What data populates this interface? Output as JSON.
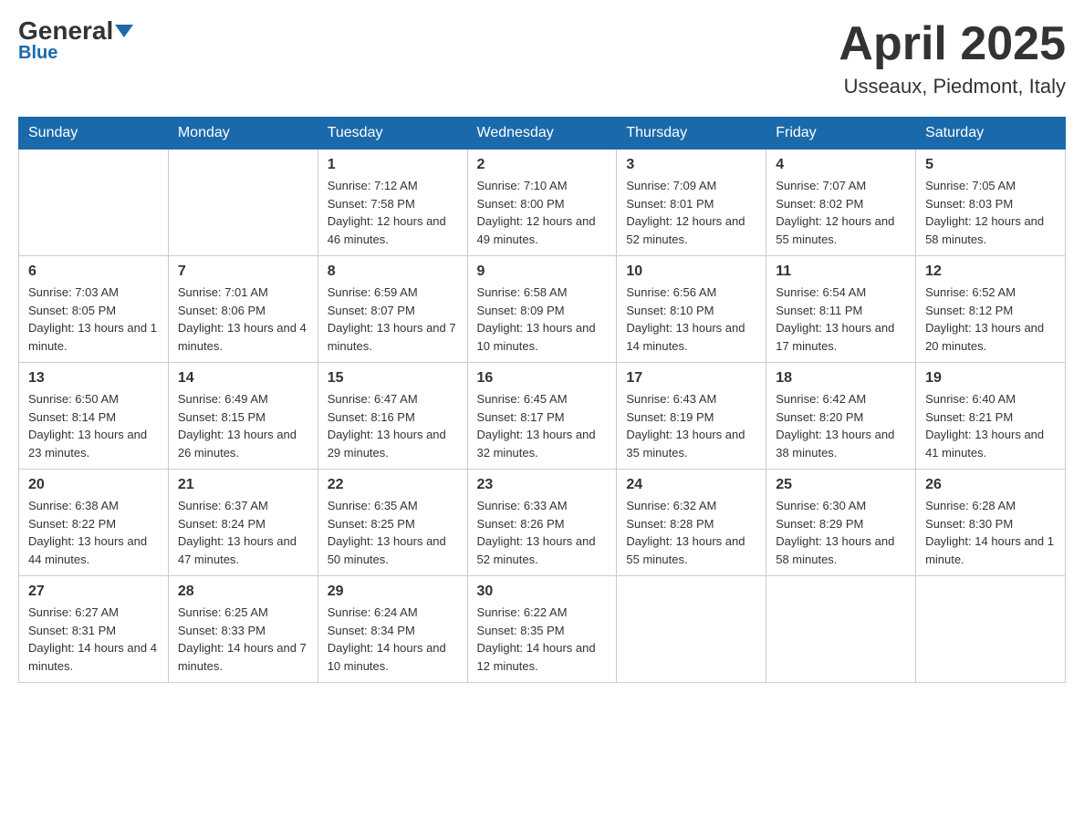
{
  "header": {
    "logo_general": "General",
    "logo_blue": "Blue",
    "month_year": "April 2025",
    "location": "Usseaux, Piedmont, Italy"
  },
  "days_of_week": [
    "Sunday",
    "Monday",
    "Tuesday",
    "Wednesday",
    "Thursday",
    "Friday",
    "Saturday"
  ],
  "weeks": [
    [
      {
        "day": "",
        "sunrise": "",
        "sunset": "",
        "daylight": ""
      },
      {
        "day": "",
        "sunrise": "",
        "sunset": "",
        "daylight": ""
      },
      {
        "day": "1",
        "sunrise": "Sunrise: 7:12 AM",
        "sunset": "Sunset: 7:58 PM",
        "daylight": "Daylight: 12 hours and 46 minutes."
      },
      {
        "day": "2",
        "sunrise": "Sunrise: 7:10 AM",
        "sunset": "Sunset: 8:00 PM",
        "daylight": "Daylight: 12 hours and 49 minutes."
      },
      {
        "day": "3",
        "sunrise": "Sunrise: 7:09 AM",
        "sunset": "Sunset: 8:01 PM",
        "daylight": "Daylight: 12 hours and 52 minutes."
      },
      {
        "day": "4",
        "sunrise": "Sunrise: 7:07 AM",
        "sunset": "Sunset: 8:02 PM",
        "daylight": "Daylight: 12 hours and 55 minutes."
      },
      {
        "day": "5",
        "sunrise": "Sunrise: 7:05 AM",
        "sunset": "Sunset: 8:03 PM",
        "daylight": "Daylight: 12 hours and 58 minutes."
      }
    ],
    [
      {
        "day": "6",
        "sunrise": "Sunrise: 7:03 AM",
        "sunset": "Sunset: 8:05 PM",
        "daylight": "Daylight: 13 hours and 1 minute."
      },
      {
        "day": "7",
        "sunrise": "Sunrise: 7:01 AM",
        "sunset": "Sunset: 8:06 PM",
        "daylight": "Daylight: 13 hours and 4 minutes."
      },
      {
        "day": "8",
        "sunrise": "Sunrise: 6:59 AM",
        "sunset": "Sunset: 8:07 PM",
        "daylight": "Daylight: 13 hours and 7 minutes."
      },
      {
        "day": "9",
        "sunrise": "Sunrise: 6:58 AM",
        "sunset": "Sunset: 8:09 PM",
        "daylight": "Daylight: 13 hours and 10 minutes."
      },
      {
        "day": "10",
        "sunrise": "Sunrise: 6:56 AM",
        "sunset": "Sunset: 8:10 PM",
        "daylight": "Daylight: 13 hours and 14 minutes."
      },
      {
        "day": "11",
        "sunrise": "Sunrise: 6:54 AM",
        "sunset": "Sunset: 8:11 PM",
        "daylight": "Daylight: 13 hours and 17 minutes."
      },
      {
        "day": "12",
        "sunrise": "Sunrise: 6:52 AM",
        "sunset": "Sunset: 8:12 PM",
        "daylight": "Daylight: 13 hours and 20 minutes."
      }
    ],
    [
      {
        "day": "13",
        "sunrise": "Sunrise: 6:50 AM",
        "sunset": "Sunset: 8:14 PM",
        "daylight": "Daylight: 13 hours and 23 minutes."
      },
      {
        "day": "14",
        "sunrise": "Sunrise: 6:49 AM",
        "sunset": "Sunset: 8:15 PM",
        "daylight": "Daylight: 13 hours and 26 minutes."
      },
      {
        "day": "15",
        "sunrise": "Sunrise: 6:47 AM",
        "sunset": "Sunset: 8:16 PM",
        "daylight": "Daylight: 13 hours and 29 minutes."
      },
      {
        "day": "16",
        "sunrise": "Sunrise: 6:45 AM",
        "sunset": "Sunset: 8:17 PM",
        "daylight": "Daylight: 13 hours and 32 minutes."
      },
      {
        "day": "17",
        "sunrise": "Sunrise: 6:43 AM",
        "sunset": "Sunset: 8:19 PM",
        "daylight": "Daylight: 13 hours and 35 minutes."
      },
      {
        "day": "18",
        "sunrise": "Sunrise: 6:42 AM",
        "sunset": "Sunset: 8:20 PM",
        "daylight": "Daylight: 13 hours and 38 minutes."
      },
      {
        "day": "19",
        "sunrise": "Sunrise: 6:40 AM",
        "sunset": "Sunset: 8:21 PM",
        "daylight": "Daylight: 13 hours and 41 minutes."
      }
    ],
    [
      {
        "day": "20",
        "sunrise": "Sunrise: 6:38 AM",
        "sunset": "Sunset: 8:22 PM",
        "daylight": "Daylight: 13 hours and 44 minutes."
      },
      {
        "day": "21",
        "sunrise": "Sunrise: 6:37 AM",
        "sunset": "Sunset: 8:24 PM",
        "daylight": "Daylight: 13 hours and 47 minutes."
      },
      {
        "day": "22",
        "sunrise": "Sunrise: 6:35 AM",
        "sunset": "Sunset: 8:25 PM",
        "daylight": "Daylight: 13 hours and 50 minutes."
      },
      {
        "day": "23",
        "sunrise": "Sunrise: 6:33 AM",
        "sunset": "Sunset: 8:26 PM",
        "daylight": "Daylight: 13 hours and 52 minutes."
      },
      {
        "day": "24",
        "sunrise": "Sunrise: 6:32 AM",
        "sunset": "Sunset: 8:28 PM",
        "daylight": "Daylight: 13 hours and 55 minutes."
      },
      {
        "day": "25",
        "sunrise": "Sunrise: 6:30 AM",
        "sunset": "Sunset: 8:29 PM",
        "daylight": "Daylight: 13 hours and 58 minutes."
      },
      {
        "day": "26",
        "sunrise": "Sunrise: 6:28 AM",
        "sunset": "Sunset: 8:30 PM",
        "daylight": "Daylight: 14 hours and 1 minute."
      }
    ],
    [
      {
        "day": "27",
        "sunrise": "Sunrise: 6:27 AM",
        "sunset": "Sunset: 8:31 PM",
        "daylight": "Daylight: 14 hours and 4 minutes."
      },
      {
        "day": "28",
        "sunrise": "Sunrise: 6:25 AM",
        "sunset": "Sunset: 8:33 PM",
        "daylight": "Daylight: 14 hours and 7 minutes."
      },
      {
        "day": "29",
        "sunrise": "Sunrise: 6:24 AM",
        "sunset": "Sunset: 8:34 PM",
        "daylight": "Daylight: 14 hours and 10 minutes."
      },
      {
        "day": "30",
        "sunrise": "Sunrise: 6:22 AM",
        "sunset": "Sunset: 8:35 PM",
        "daylight": "Daylight: 14 hours and 12 minutes."
      },
      {
        "day": "",
        "sunrise": "",
        "sunset": "",
        "daylight": ""
      },
      {
        "day": "",
        "sunrise": "",
        "sunset": "",
        "daylight": ""
      },
      {
        "day": "",
        "sunrise": "",
        "sunset": "",
        "daylight": ""
      }
    ]
  ]
}
